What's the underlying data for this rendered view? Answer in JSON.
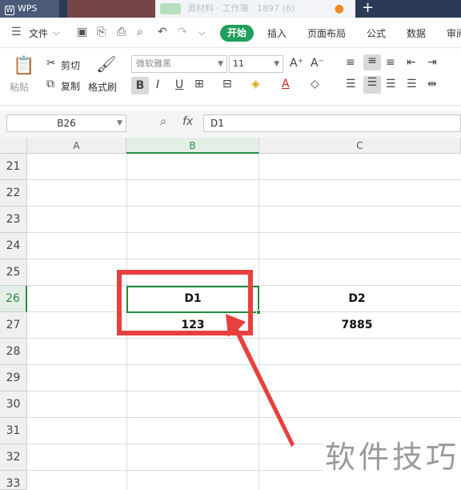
{
  "titlebar": {
    "app_name": "WPS",
    "doc_tab": "源材料 · 工作簿 · 1897 (6)",
    "new_tab": "+"
  },
  "menu": {
    "file": "文件",
    "start": "开始",
    "tabs": [
      "插入",
      "页面布局",
      "公式",
      "数据",
      "审阅"
    ]
  },
  "ribbon": {
    "paste": "粘贴",
    "cut": "剪切",
    "copy": "复制",
    "format_painter": "格式刷",
    "font_name": "微软雅黑",
    "font_size": "11",
    "bold": "B",
    "italic": "I",
    "underline": "U",
    "font_color_letter": "A"
  },
  "formula_bar": {
    "cell_ref": "B26",
    "fx": "fx",
    "content": "D1"
  },
  "columns": [
    "A",
    "B",
    "C"
  ],
  "rows": [
    "21",
    "22",
    "23",
    "24",
    "25",
    "26",
    "27",
    "28",
    "29",
    "30",
    "31",
    "32",
    "33"
  ],
  "cells": {
    "B26": "D1",
    "C26": "D2",
    "B27": "123",
    "C27": "7885"
  },
  "watermark": "软件技巧",
  "colors": {
    "accent_green": "#1f9e5a",
    "highlight_red": "#e8403f",
    "selection": "#1f8f3e"
  }
}
